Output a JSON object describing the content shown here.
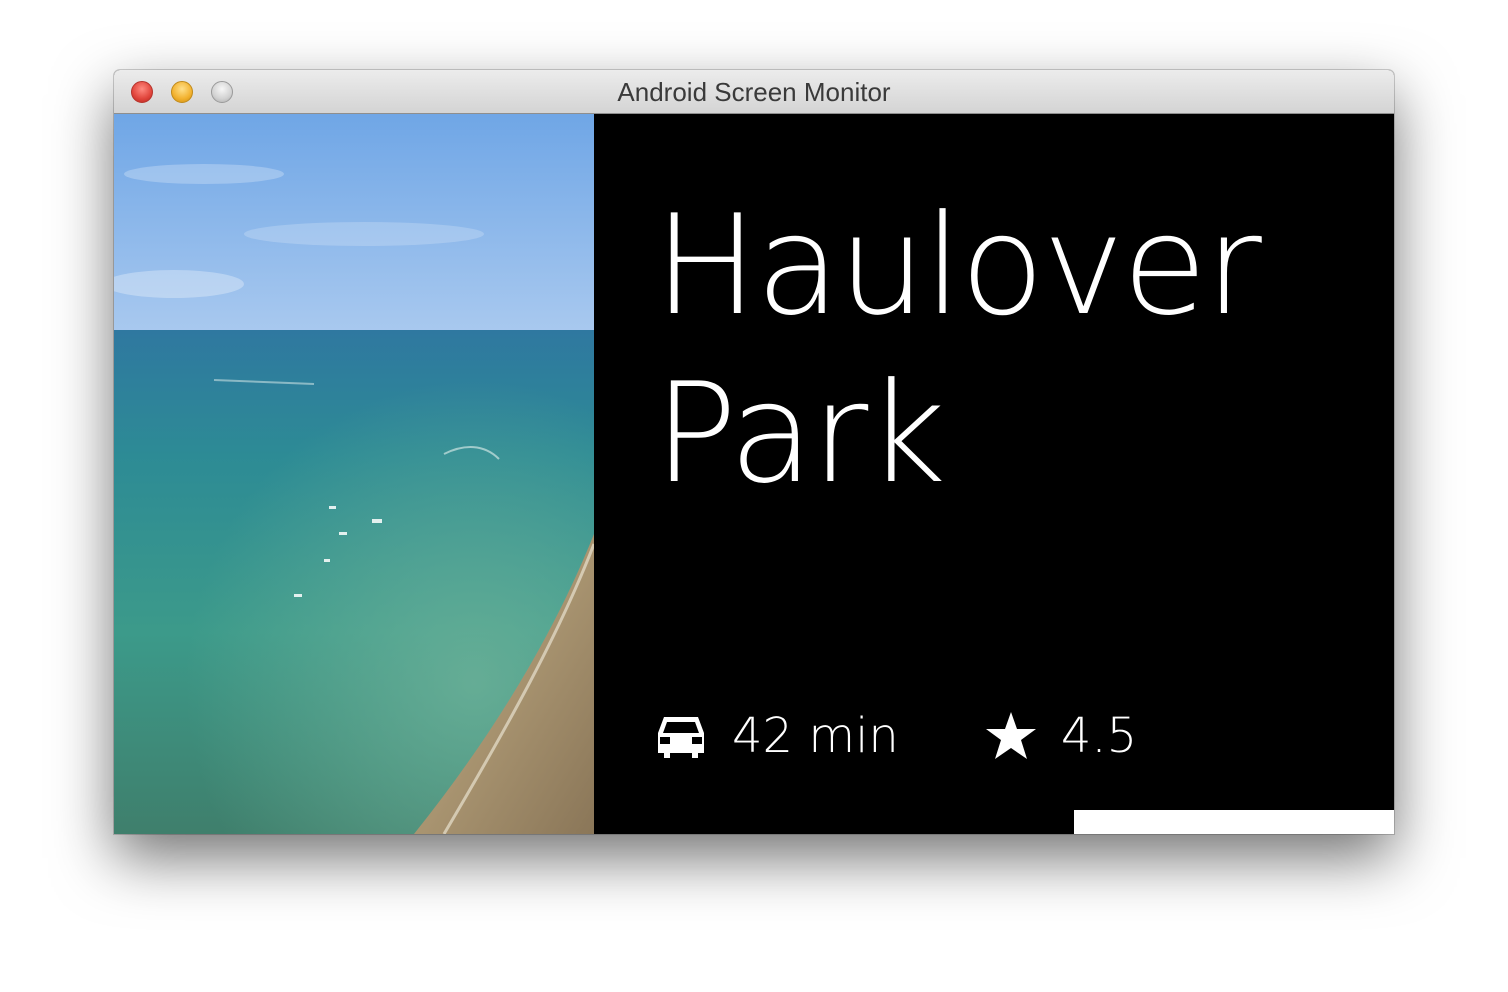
{
  "window": {
    "title": "Android Screen Monitor"
  },
  "card": {
    "title_line1": "Haulover",
    "title_line2": "Park",
    "drive_time": "42 min",
    "rating": "4.5",
    "progress_fraction": 0.4
  },
  "icons": {
    "close": "close-button-icon",
    "minimize": "minimize-button-icon",
    "zoom": "zoom-button-icon",
    "car": "car-icon",
    "star": "star-icon"
  },
  "colors": {
    "background": "#000000",
    "text": "#ffffff"
  }
}
